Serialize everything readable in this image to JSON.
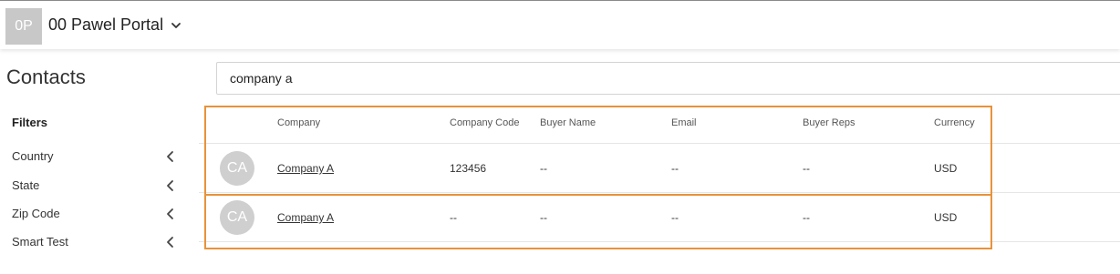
{
  "header": {
    "portal_initials": "0P",
    "portal_name": "00 Pawel Portal",
    "chevron_icon": "chevron-down-icon"
  },
  "page": {
    "title": "Contacts"
  },
  "search": {
    "value": "company a",
    "placeholder": ""
  },
  "filters": {
    "title": "Filters",
    "items": [
      {
        "label": "Country",
        "icon": "chevron-left-icon"
      },
      {
        "label": "State",
        "icon": "chevron-left-icon"
      },
      {
        "label": "Zip Code",
        "icon": "chevron-left-icon"
      },
      {
        "label": "Smart Test",
        "icon": "chevron-left-icon"
      }
    ]
  },
  "table": {
    "columns": [
      "Company",
      "Company Code",
      "Buyer Name",
      "Email",
      "Buyer Reps",
      "Currency"
    ],
    "rows": [
      {
        "initials": "CA",
        "company": "Company A",
        "company_code": "123456",
        "buyer_name": "--",
        "email": "--",
        "buyer_reps": "--",
        "currency": "USD"
      },
      {
        "initials": "CA",
        "company": "Company A",
        "company_code": "--",
        "buyer_name": "--",
        "email": "--",
        "buyer_reps": "--",
        "currency": "USD"
      }
    ]
  },
  "colors": {
    "highlight": "#e8923a",
    "avatar": "#cfcfcf",
    "portal_avatar": "#c8c8c8"
  }
}
